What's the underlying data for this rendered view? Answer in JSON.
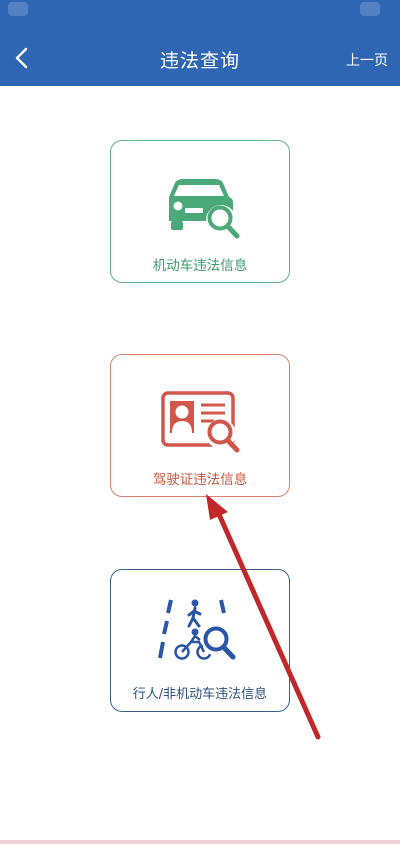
{
  "header": {
    "title": "违法查询",
    "prev_label": "上一页"
  },
  "cards": {
    "vehicle": {
      "label": "机动车违法信息",
      "icon": "car-search-icon",
      "color": "#4aa879"
    },
    "license": {
      "label": "驾驶证违法信息",
      "icon": "license-search-icon",
      "color": "#d0574a"
    },
    "pedestrian": {
      "label": "行人/非机动车违法信息",
      "icon": "pedestrian-bike-search-icon",
      "color": "#2b55a5"
    }
  },
  "colors": {
    "header_bg": "#2f66b4",
    "annotation_arrow": "#c0282a"
  }
}
